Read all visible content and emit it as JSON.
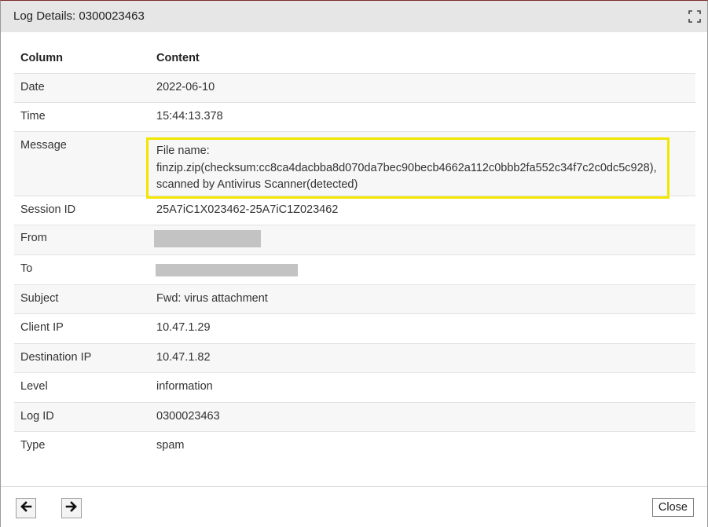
{
  "dialog": {
    "title": "Log Details: 0300023463",
    "expand_icon": "expand-icon"
  },
  "table": {
    "headers": {
      "column": "Column",
      "content": "Content"
    },
    "rows": [
      {
        "column": "Date",
        "content": "2022-06-10"
      },
      {
        "column": "Time",
        "content": "15:44:13.378"
      },
      {
        "column": "Message",
        "content_lines": [
          "File name:",
          "finzip.zip(checksum:cc8ca4dacbba8d070da7bec90becb4662a112c0bbb2fa552c34f7c2c0dc5c928),",
          "scanned by Antivirus Scanner(detected)"
        ],
        "highlight_color": "#f2e600"
      },
      {
        "column": "Session ID",
        "content": "25A7iC1X023462-25A7iC1Z023462"
      },
      {
        "column": "From",
        "content": "",
        "redacted": true
      },
      {
        "column": "To",
        "content": "",
        "redacted": true
      },
      {
        "column": "Subject",
        "content": "Fwd: virus attachment"
      },
      {
        "column": "Client IP",
        "content": "10.47.1.29"
      },
      {
        "column": "Destination IP",
        "content": "10.47.1.82"
      },
      {
        "column": "Level",
        "content": "information"
      },
      {
        "column": "Log ID",
        "content": "0300023463"
      },
      {
        "column": "Type",
        "content": "spam"
      }
    ]
  },
  "footer": {
    "prev_icon": "arrow-left-icon",
    "next_icon": "arrow-right-icon",
    "close_label": "Close"
  }
}
